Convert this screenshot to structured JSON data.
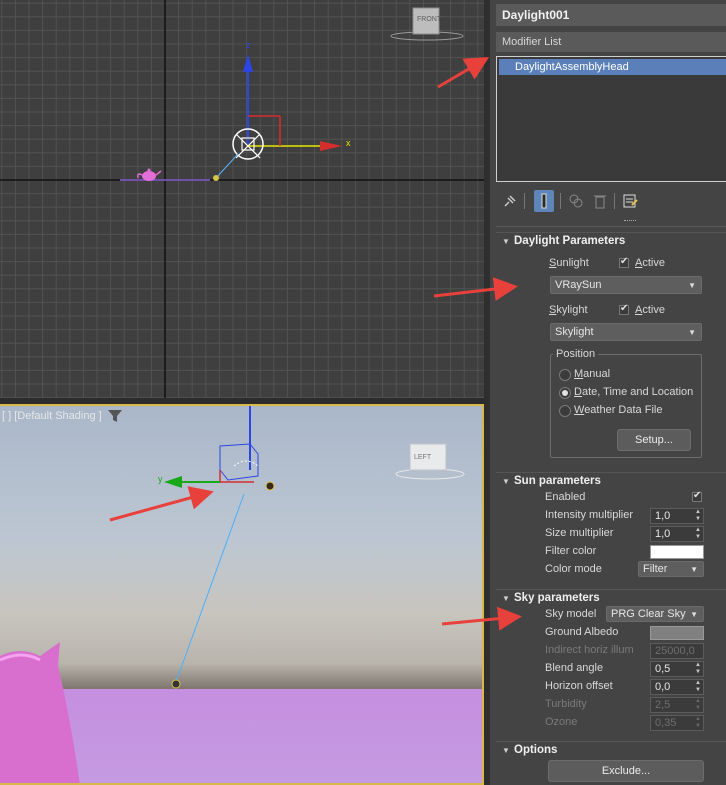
{
  "top_viewport": {
    "navcube_label": "FRONT",
    "axis_x_label": "x",
    "axis_z_label": "z"
  },
  "persp_viewport": {
    "label": "[ ] [Default Shading ]",
    "navcube_label": "LEFT",
    "axis_y_label": "y"
  },
  "panel": {
    "object_name": "Daylight001",
    "modifier_list_label": "Modifier List",
    "stack_items": [
      "DaylightAssemblyHead"
    ],
    "toolbar_icons": [
      "pin-icon",
      "show-end-result-icon",
      "make-unique-icon",
      "remove-modifier-icon",
      "configure-modifier-sets-icon"
    ]
  },
  "daylight_parameters": {
    "title": "Daylight Parameters",
    "sunlight_label": "Sunlight",
    "sunlight_active_label": "Active",
    "sunlight_active": true,
    "sunlight_type": "VRaySun",
    "skylight_label": "Skylight",
    "skylight_active_label": "Active",
    "skylight_active": true,
    "skylight_type": "Skylight",
    "position_group_title": "Position",
    "position_options": [
      "Manual",
      "Date, Time and Location",
      "Weather Data File"
    ],
    "position_selected": "Date, Time and Location",
    "setup_button": "Setup..."
  },
  "sun_parameters": {
    "title": "Sun parameters",
    "enabled_label": "Enabled",
    "enabled": true,
    "intensity_label": "Intensity multiplier",
    "intensity_value": "1,0",
    "size_label": "Size multiplier",
    "size_value": "1,0",
    "filter_color_label": "Filter color",
    "filter_color": "#ffffff",
    "color_mode_label": "Color mode",
    "color_mode_value": "Filter"
  },
  "sky_parameters": {
    "title": "Sky parameters",
    "sky_model_label": "Sky model",
    "sky_model_value": "PRG Clear Sky",
    "ground_albedo_label": "Ground Albedo",
    "ground_albedo_color": "#808080",
    "indirect_label": "Indirect horiz illum",
    "indirect_value": "25000,0",
    "blend_label": "Blend angle",
    "blend_value": "0,5",
    "horizon_label": "Horizon offset",
    "horizon_value": "0,0",
    "turbidity_label": "Turbidity",
    "turbidity_value": "2,5",
    "ozone_label": "Ozone",
    "ozone_value": "0,35"
  },
  "options": {
    "title": "Options",
    "exclude_button": "Exclude..."
  },
  "colors": {
    "accent_selection": "#5b7fb8",
    "annotation_arrow": "#e8403a",
    "viewport_active_border": "#d9b84a"
  }
}
